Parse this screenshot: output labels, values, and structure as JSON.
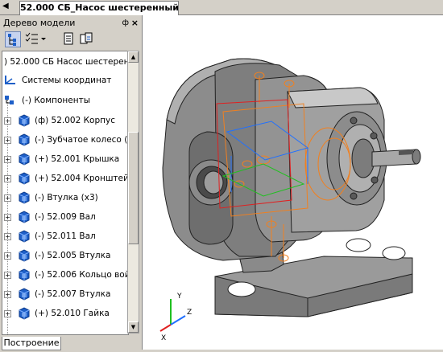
{
  "document": {
    "tab_title": "52.000 СБ_Насос шестеренный"
  },
  "tree_panel": {
    "title": "Дерево модели",
    "pin_glyph": "ф",
    "close_glyph": "×",
    "root_label": ") 52.000 СБ Насос  шестеренны",
    "coord_label": "Системы координат",
    "components_label": "(-) Компоненты",
    "items": [
      {
        "label": "(ф) 52.002 Корпус"
      },
      {
        "label": "(-) Зубчатое колесо ("
      },
      {
        "label": "(+) 52.001 Крышка"
      },
      {
        "label": "(+) 52.004 Кронштейн"
      },
      {
        "label": "(-) Втулка (x3)"
      },
      {
        "label": "(-) 52.009 Вал"
      },
      {
        "label": "(-) 52.011 Вал"
      },
      {
        "label": "(-) 52.005 Втулка"
      },
      {
        "label": "(-) 52.006 Кольцо вой"
      },
      {
        "label": "(-) 52.007 Втулка"
      },
      {
        "label": "(+) 52.010 Гайка"
      }
    ],
    "bottom_tab": "Построение"
  },
  "triad": {
    "x_label": "X",
    "y_label": "Y",
    "z_label": "Z"
  },
  "colors": {
    "tree_icon": "#1e5fc8",
    "shaded_metal": "#8a8a8a",
    "edges": "#222222",
    "sketch_orange": "#f08020",
    "sketch_blue": "#2070ff",
    "sketch_green": "#20c020",
    "sketch_red": "#e02020"
  }
}
